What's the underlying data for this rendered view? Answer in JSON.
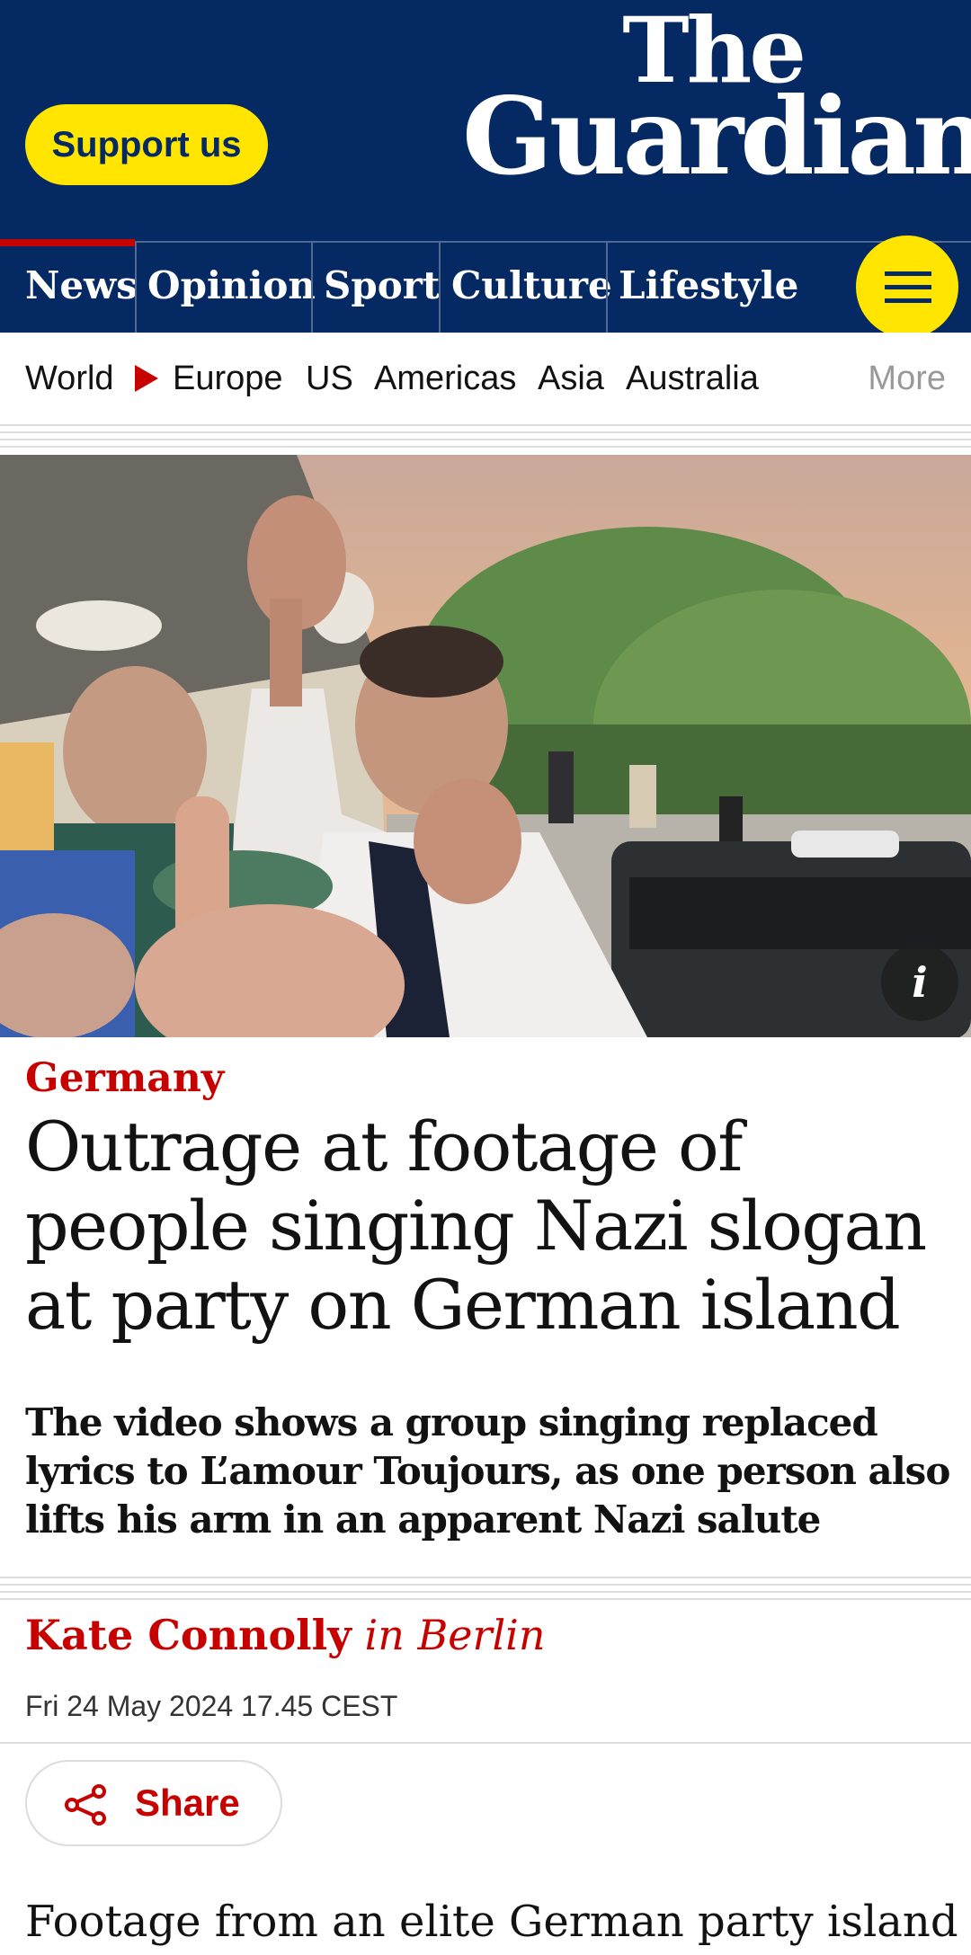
{
  "header": {
    "support_label": "Support us",
    "logo_line1": "The",
    "logo_line2": "Guardian"
  },
  "pillars": [
    "News",
    "Opinion",
    "Sport",
    "Culture",
    "Lifestyle"
  ],
  "active_pillar": "News",
  "menu_icon": "hamburger-menu-icon",
  "subnav": [
    "World",
    "Europe",
    "US",
    "Americas",
    "Asia",
    "Australia"
  ],
  "subnav_more": "More",
  "hero": {
    "info_label": "i"
  },
  "article": {
    "kicker": "Germany",
    "headline": "Outrage at footage of people singing Nazi slogan at party on German island",
    "standfirst": "The video shows a group singing replaced lyrics to L’amour Toujours, as one person also lifts his arm in an apparent Nazi salute",
    "byline_name": "Kate Connolly",
    "byline_location": "in Berlin",
    "date": "Fri 24 May 2024 17.45 CEST",
    "share_label": "Share",
    "body_first_line": "Footage from an elite German party island of"
  },
  "colors": {
    "brand_navy": "#052962",
    "support_yellow": "#ffe500",
    "news_red": "#c70000"
  }
}
